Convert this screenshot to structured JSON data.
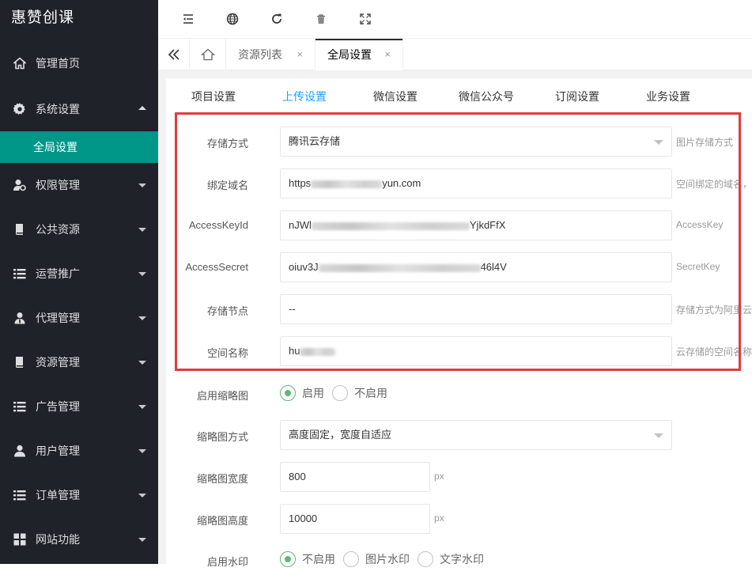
{
  "app": {
    "brand": "惠赞创课"
  },
  "sidebar": {
    "items": [
      {
        "label": "管理首页",
        "icon": "home-icon"
      },
      {
        "label": "系统设置",
        "icon": "gear-icon",
        "expanded": true,
        "children": [
          {
            "label": "全局设置",
            "active": true
          }
        ]
      },
      {
        "label": "权限管理",
        "icon": "user-key-icon"
      },
      {
        "label": "公共资源",
        "icon": "book-icon"
      },
      {
        "label": "运营推广",
        "icon": "list-icon"
      },
      {
        "label": "代理管理",
        "icon": "agent-icon"
      },
      {
        "label": "资源管理",
        "icon": "book-icon"
      },
      {
        "label": "广告管理",
        "icon": "list-icon"
      },
      {
        "label": "用户管理",
        "icon": "user-icon"
      },
      {
        "label": "订单管理",
        "icon": "list-icon"
      },
      {
        "label": "网站功能",
        "icon": "grid-icon"
      }
    ]
  },
  "toolbar": {
    "icons": [
      "menu-collapse-icon",
      "globe-icon",
      "refresh-icon",
      "trash-icon",
      "fullscreen-icon"
    ]
  },
  "tabs": {
    "items": [
      {
        "label": "资源列表",
        "close": "×"
      },
      {
        "label": "全局设置",
        "close": "×",
        "active": true
      }
    ]
  },
  "settings_tabs": [
    {
      "label": "项目设置"
    },
    {
      "label": "上传设置",
      "active": true
    },
    {
      "label": "微信设置"
    },
    {
      "label": "微信公众号"
    },
    {
      "label": "订阅设置"
    },
    {
      "label": "业务设置"
    }
  ],
  "form": {
    "storage_method": {
      "label": "存储方式",
      "value": "腾讯云存储",
      "hint": "图片存储方式"
    },
    "domain": {
      "label": "绑定域名",
      "value_prefix": "https",
      "value_suffix": "yun.com",
      "hint": "空间绑定的域名，"
    },
    "access_key_id": {
      "label": "AccessKeyId",
      "value_prefix": "nJWl",
      "value_suffix": "YjkdFfX",
      "hint": "AccessKey"
    },
    "access_secret": {
      "label": "AccessSecret",
      "value_prefix": "oiuv3J",
      "value_suffix": "46l4V",
      "hint": "SecretKey"
    },
    "storage_node": {
      "label": "存储节点",
      "value": "--",
      "hint": "存储方式为阿里云"
    },
    "space_name": {
      "label": "空间名称",
      "value_prefix": "hu",
      "hint": "云存储的空间名称"
    },
    "thumbnail_enable": {
      "label": "启用缩略图",
      "options": [
        "启用",
        "不启用"
      ],
      "selected": "启用"
    },
    "thumbnail_mode": {
      "label": "缩略图方式",
      "value": "高度固定，宽度自适应"
    },
    "thumbnail_width": {
      "label": "缩略图宽度",
      "value": "800",
      "unit": "px"
    },
    "thumbnail_height": {
      "label": "缩略图高度",
      "value": "10000",
      "unit": "px"
    },
    "watermark": {
      "label": "启用水印",
      "options": [
        "不启用",
        "图片水印",
        "文字水印"
      ],
      "selected": "不启用"
    }
  },
  "colors": {
    "sidebar_bg": "#20222a",
    "active_menu": "#009688",
    "active_tab": "#1e9fff",
    "radio_checked": "#5FB878",
    "highlight_border": "#e23b3b"
  }
}
